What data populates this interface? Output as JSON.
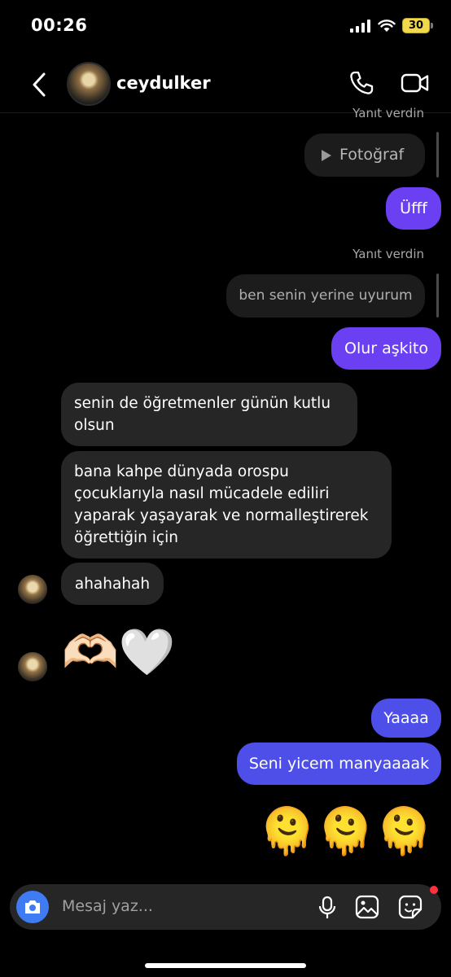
{
  "status": {
    "time": "00:26",
    "battery": "30"
  },
  "header": {
    "username": "ceydulker"
  },
  "messages": {
    "reply_label_1": "Yanıt verdin",
    "quoted_1": "Fotoğraf",
    "me_1": "Üfff",
    "reply_label_2": "Yanıt verdin",
    "quoted_2": "ben senin yerine uyurum",
    "me_2": "Olur aşkito",
    "them_1": "senin de öğretmenler günün kutlu olsun",
    "them_2": "bana kahpe dünyada orospu çocuklarıyla nasıl mücadele ediliri yaparak yaşayarak ve normalleştirerek öğrettiğin için",
    "them_3": "ahahahah",
    "them_emoji": "🫶🏻🤍",
    "me_3": "Yaaaa",
    "me_4": "Seni yicem manyaaaak",
    "me_emoji": "🫠🫠🫠"
  },
  "composer": {
    "placeholder": "Mesaj yaz..."
  },
  "colors": {
    "accent_purple": "#6b3ff2",
    "accent_blue": "#4d4fe8",
    "bubble_gray": "#262626"
  }
}
